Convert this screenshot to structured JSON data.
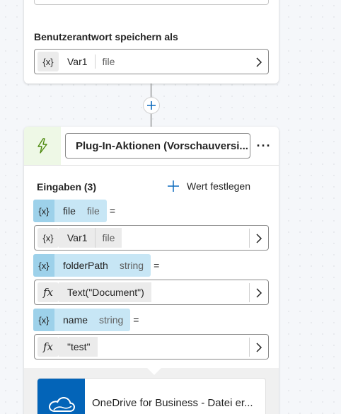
{
  "top_card": {
    "save_label": "Benutzerantwort speichern als",
    "save_var": {
      "icon": "{x}",
      "name": "Var1",
      "type": "file"
    }
  },
  "plugin_card": {
    "title": "Plug-In-Aktionen (Vorschauversi...",
    "more": "···",
    "inputs_label": "Eingaben (3)",
    "set_value_label": "Wert festlegen",
    "params": [
      {
        "icon": "{x}",
        "name": "file",
        "type": "file",
        "eq": "=",
        "value": {
          "icon": "{x}",
          "text": "Var1",
          "type": "file"
        }
      },
      {
        "icon": "{x}",
        "name": "folderPath",
        "type": "string",
        "eq": "=",
        "value": {
          "icon": "fx",
          "text": "Text(\"Document\")"
        }
      },
      {
        "icon": "{x}",
        "name": "name",
        "type": "string",
        "eq": "=",
        "value": {
          "icon": "fx",
          "text": "\"test\""
        }
      }
    ]
  },
  "connector": {
    "text": "OneDrive for Business - Datei er..."
  },
  "colors": {
    "accent": "#0f6cbd",
    "param_bg": "#c7e6f5",
    "plugin_icon_bg": "#eef8e6",
    "onedrive": "#0364b8"
  }
}
